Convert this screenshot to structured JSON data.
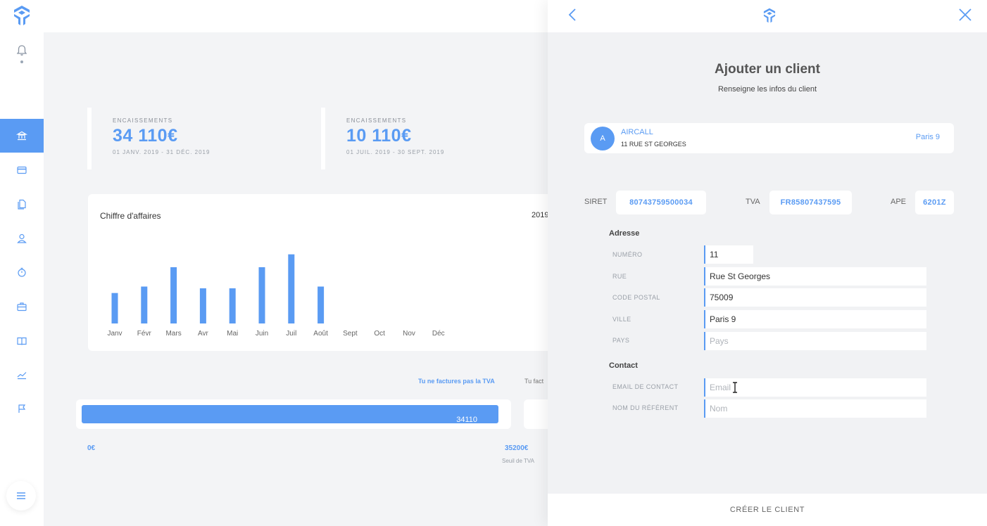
{
  "brand": {
    "logo": "brand-logo-icon",
    "accent": "#5a9bf3"
  },
  "sidebar": {
    "items": [
      {
        "icon": "bell-icon"
      },
      {
        "icon": "bank-icon",
        "active": true
      },
      {
        "icon": "card-icon"
      },
      {
        "icon": "documents-icon"
      },
      {
        "icon": "user-icon"
      },
      {
        "icon": "stopwatch-icon"
      },
      {
        "icon": "briefcase-icon"
      },
      {
        "icon": "book-icon"
      },
      {
        "icon": "trend-icon"
      },
      {
        "icon": "flag-icon"
      },
      {
        "icon": "menu-icon"
      }
    ]
  },
  "dashboard": {
    "kpis": [
      {
        "label": "ENCAISSEMENTS",
        "value": "34 110€",
        "period": "01 JANV. 2019 - 31 DÉC. 2019"
      },
      {
        "label": "ENCAISSEMENTS",
        "value": "10 110€",
        "period": "01 JUIL. 2019 - 30 SEPT. 2019"
      }
    ],
    "chart_title": "Chiffre d'affaires",
    "chart_year": "2019",
    "tva_label": "Tu ne factures pas la TVA",
    "tva_label_cut": "Tu fact",
    "progress_value": "34110",
    "scale_min": "0€",
    "scale_max": "35200€",
    "scale_note": "Seuil de TVA"
  },
  "chart_data": {
    "type": "bar",
    "title": "Chiffre d'affaires",
    "xlabel": "",
    "ylabel": "",
    "categories": [
      "Janv",
      "Févr",
      "Mars",
      "Avr",
      "Mai",
      "Juin",
      "Juil",
      "Août",
      "Sept",
      "Oct",
      "Nov",
      "Déc"
    ],
    "values": [
      2600,
      3150,
      4800,
      3000,
      3000,
      4800,
      5900,
      3150,
      0,
      0,
      0,
      0
    ],
    "ylim": [
      0,
      6000
    ],
    "grid": false,
    "color": "#5a9bf3"
  },
  "panel": {
    "title": "Ajouter un client",
    "subtitle": "Renseigne les infos du client",
    "client": {
      "avatar_letter": "A",
      "name": "AIRCALL",
      "address": "11 RUE ST GEORGES",
      "city": "Paris 9"
    },
    "ids": [
      {
        "label": "SIRET",
        "value": "80743759500034"
      },
      {
        "label": "TVA",
        "value": "FR85807437595"
      },
      {
        "label": "APE",
        "value": "6201Z"
      }
    ],
    "address_section": "Adresse",
    "fields": {
      "numero": {
        "label": "NUMÉRO",
        "value": "11"
      },
      "rue": {
        "label": "RUE",
        "value": "Rue St Georges"
      },
      "code_postal": {
        "label": "CODE POSTAL",
        "value": "75009"
      },
      "ville": {
        "label": "VILLE",
        "value": "Paris 9"
      },
      "pays": {
        "label": "PAYS",
        "placeholder": "Pays"
      }
    },
    "contact_section": "Contact",
    "contact": {
      "email": {
        "label": "EMAIL DE CONTACT",
        "placeholder": "Email"
      },
      "referent": {
        "label": "NOM DU RÉFÉRENT",
        "placeholder": "Nom"
      }
    },
    "submit_label": "CRÉER LE CLIENT"
  }
}
